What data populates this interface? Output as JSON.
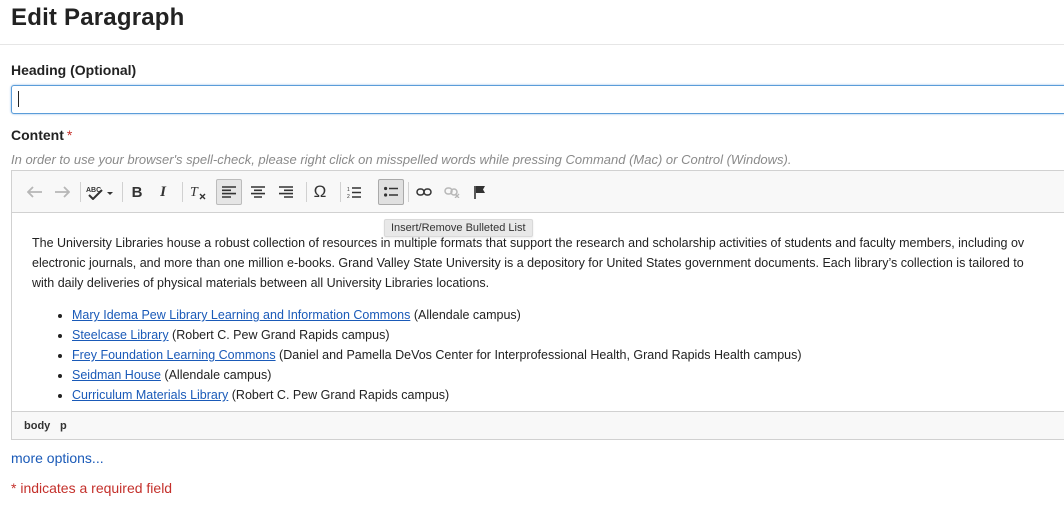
{
  "page": {
    "title": "Edit Paragraph"
  },
  "heading_field": {
    "label": "Heading (Optional)",
    "value": ""
  },
  "content_field": {
    "label": "Content",
    "required_mark": "*",
    "help": "In order to use your browser's spell-check, please right click on misspelled words while pressing Command (Mac) or Control (Windows)."
  },
  "toolbar": {
    "tooltip": "Insert/Remove Bulleted List",
    "buttons": [
      {
        "name": "undo",
        "icon": "undo-icon",
        "glyph": "↶",
        "state": "disabled"
      },
      {
        "name": "redo",
        "icon": "redo-icon",
        "glyph": "↷",
        "state": "disabled"
      },
      {
        "name": "spellcheck",
        "icon": "spellcheck-icon",
        "glyph": "ABC✓▾",
        "state": "normal"
      },
      {
        "name": "bold",
        "icon": "bold-icon",
        "glyph": "B",
        "state": "normal"
      },
      {
        "name": "italic",
        "icon": "italic-icon",
        "glyph": "I",
        "state": "normal"
      },
      {
        "name": "remove-format",
        "icon": "remove-format-icon",
        "glyph": "Tx",
        "state": "normal"
      },
      {
        "name": "align-left",
        "icon": "align-left-icon",
        "glyph": "≡",
        "state": "active"
      },
      {
        "name": "align-center",
        "icon": "align-center-icon",
        "glyph": "≡",
        "state": "normal"
      },
      {
        "name": "align-right",
        "icon": "align-right-icon",
        "glyph": "≡",
        "state": "normal"
      },
      {
        "name": "special-character",
        "icon": "omega-icon",
        "glyph": "Ω",
        "state": "normal"
      },
      {
        "name": "numbered-list",
        "icon": "numbered-list-icon",
        "glyph": "1≡",
        "state": "normal"
      },
      {
        "name": "bulleted-list",
        "icon": "bulleted-list-icon",
        "glyph": "•≡",
        "state": "hover"
      },
      {
        "name": "link",
        "icon": "link-icon",
        "glyph": "∞",
        "state": "normal"
      },
      {
        "name": "unlink",
        "icon": "unlink-icon",
        "glyph": "∞",
        "state": "disabled"
      },
      {
        "name": "anchor",
        "icon": "flag-icon",
        "glyph": "⚑",
        "state": "normal"
      }
    ]
  },
  "editor": {
    "paragraph_lines": [
      "The University Libraries house a robust collection of resources in multiple formats that support the research and scholarship activities of students and faculty members, including ov",
      "electronic journals, and more than one million e-books. Grand Valley State University is a depository for United States government documents.  Each library’s collection is tailored to",
      "with daily deliveries of physical materials between all University Libraries locations."
    ],
    "list_items": [
      {
        "link": "Mary Idema Pew Library Learning and Information Commons",
        "text": " (Allendale campus)"
      },
      {
        "link": "Steelcase Library",
        "text": " (Robert C. Pew Grand Rapids campus)"
      },
      {
        "link": "Frey Foundation Learning Commons",
        "text": " (Daniel and Pamella DeVos Center for Interprofessional Health, Grand Rapids Health campus)"
      },
      {
        "link": "Seidman House",
        "text": " (Allendale campus)"
      },
      {
        "link": "Curriculum Materials Library",
        "text": " (Robert C. Pew Grand Rapids campus)"
      }
    ],
    "element_path": [
      "body",
      "p"
    ]
  },
  "footer": {
    "more_options": "more options...",
    "required_note": "* indicates a required field"
  },
  "colors": {
    "link": "#1a5ab8",
    "required": "#c4302b",
    "focus": "#5b9dd9"
  }
}
